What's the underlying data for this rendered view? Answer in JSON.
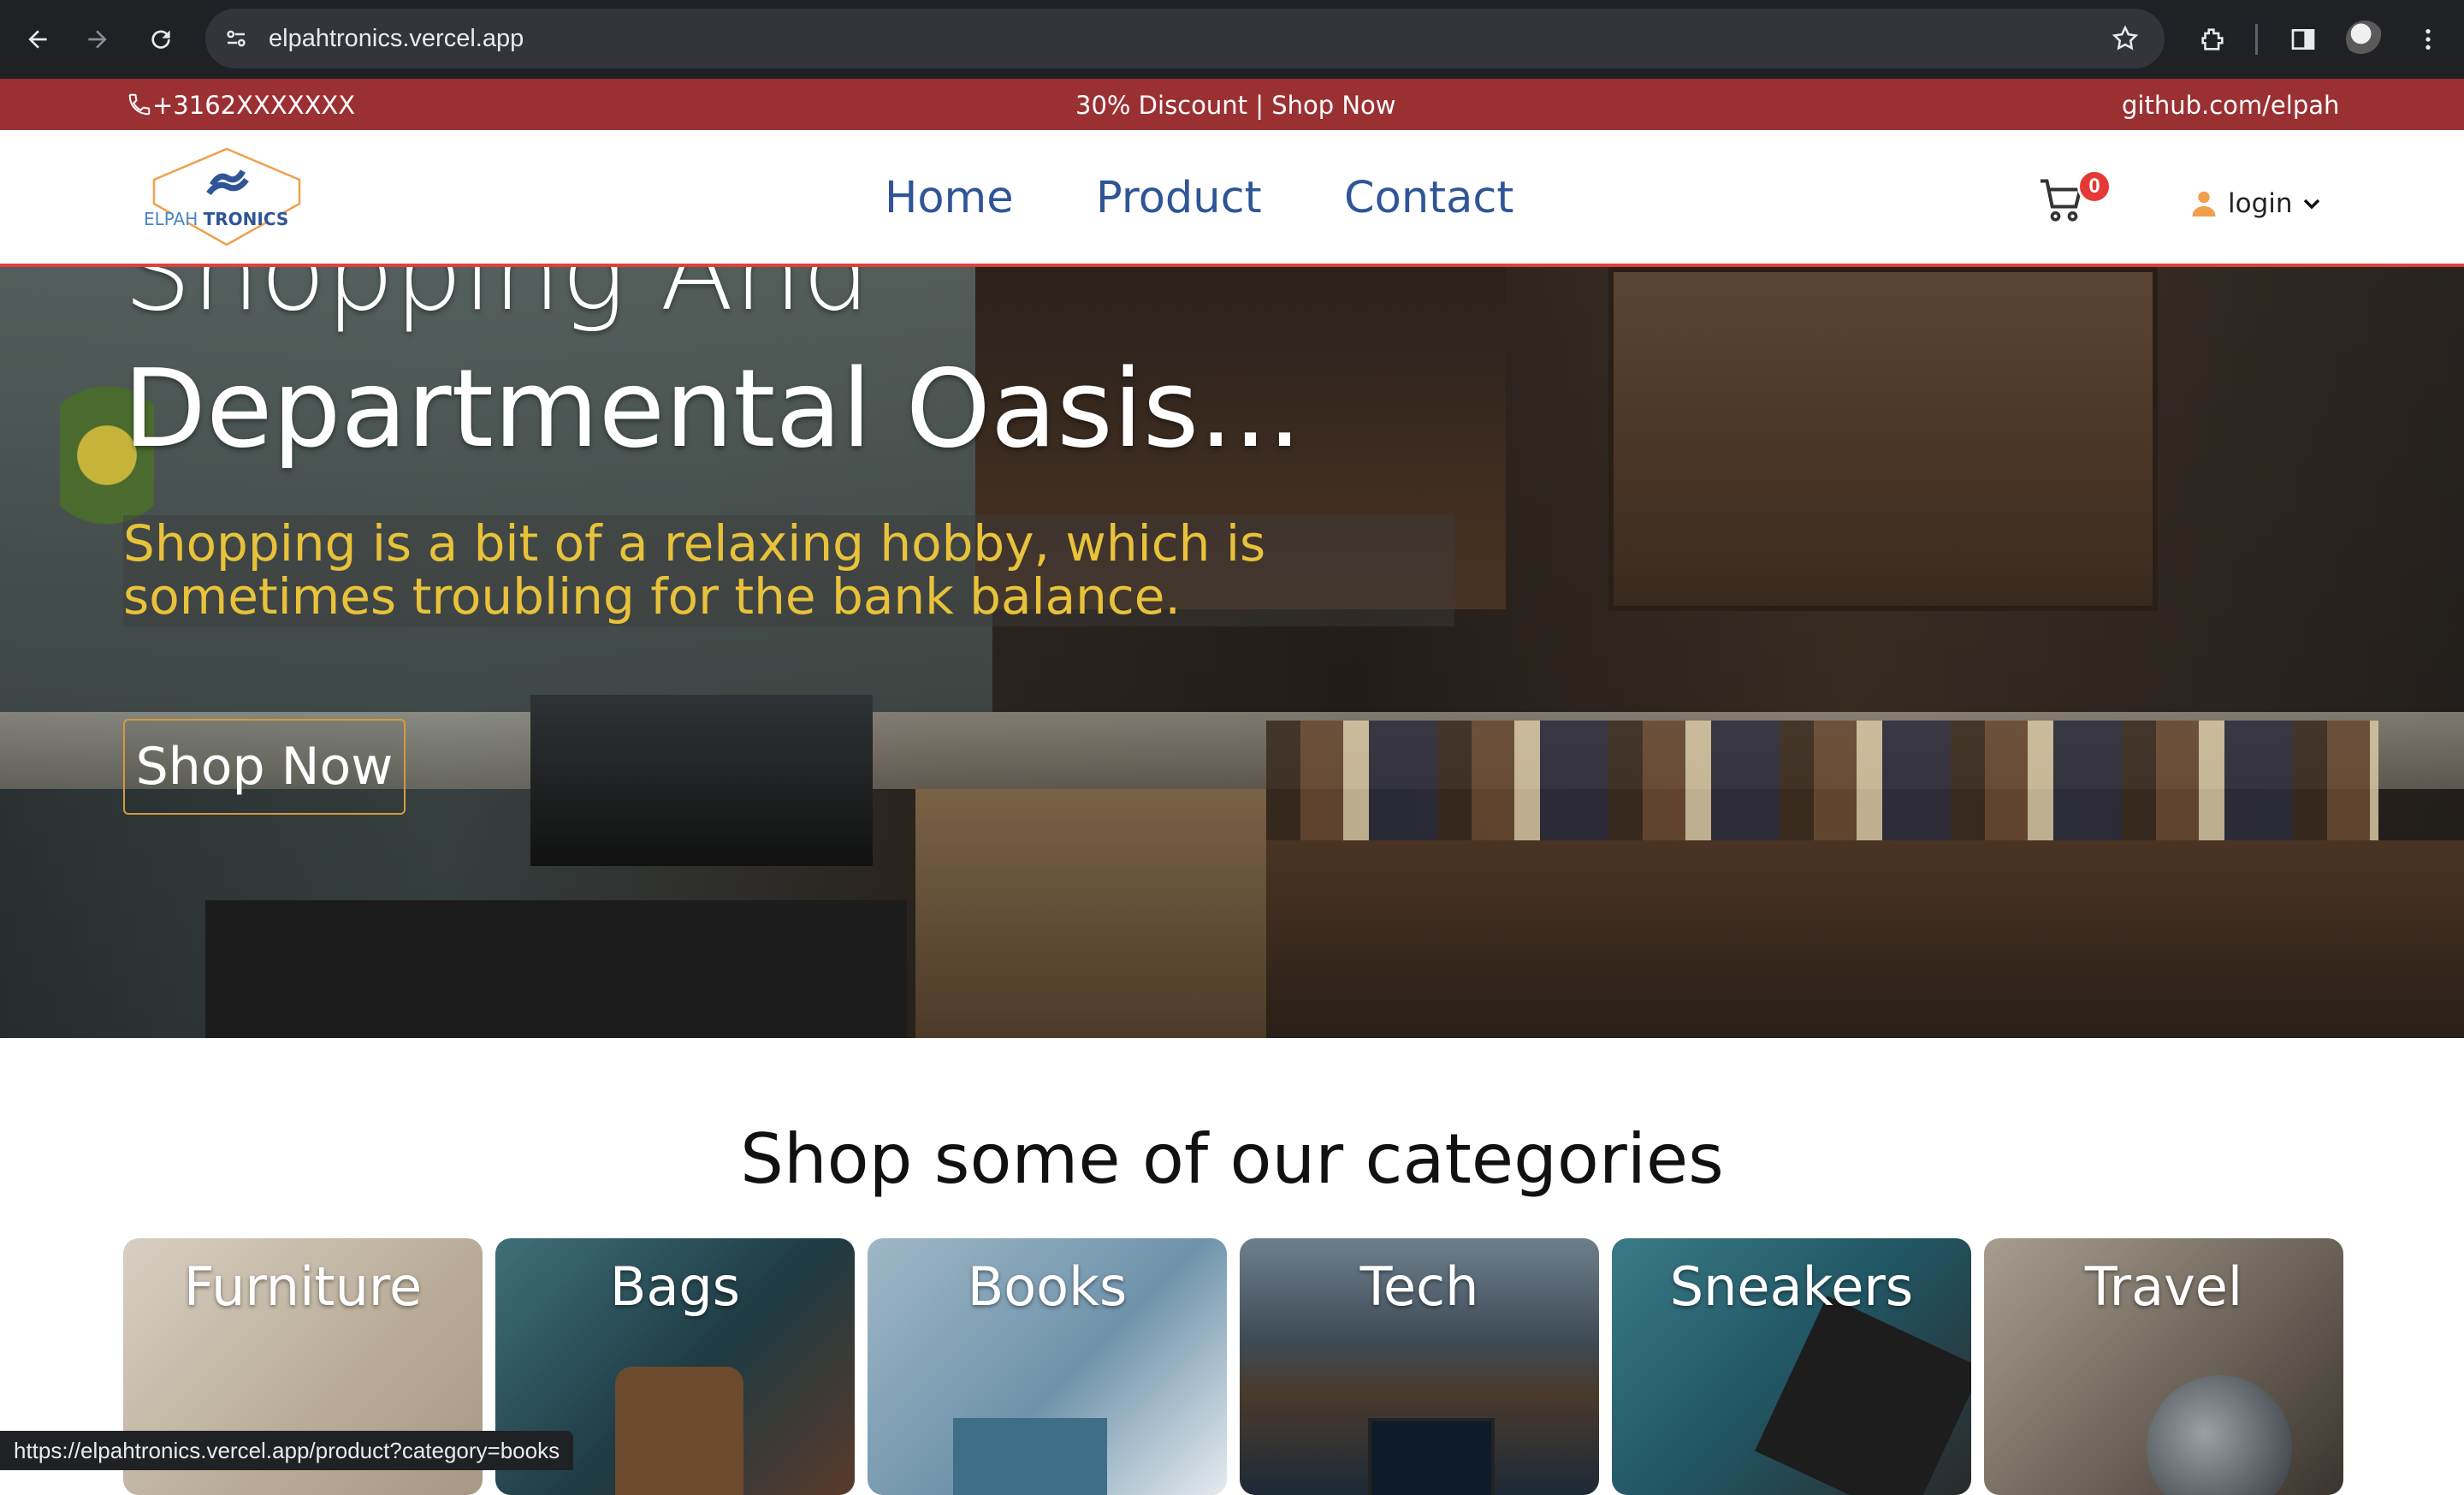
{
  "browser": {
    "url": "elpahtronics.vercel.app",
    "status_url": "https://elpahtronics.vercel.app/product?category=books"
  },
  "topbar": {
    "phone": "+3162XXXXXXX",
    "promo": "30% Discount | Shop Now",
    "github": "github.com/elpah"
  },
  "brand": {
    "logo_left": "ELPAH",
    "logo_right": "TRONICS",
    "accent_blue": "#2f5597",
    "accent_orange": "#f0a04b",
    "accent_red": "#9b3033"
  },
  "nav": {
    "items": [
      {
        "label": "Home"
      },
      {
        "label": "Product"
      },
      {
        "label": "Contact"
      }
    ],
    "cart_count": "0",
    "login_label": "login"
  },
  "hero": {
    "title_line1": "Shopping And",
    "title_line2": "Departmental Oasis...",
    "subtitle": "Shopping is a bit of a relaxing hobby, which is sometimes troubling for the bank balance.",
    "cta": "Shop Now"
  },
  "categories": {
    "heading": "Shop some of our categories",
    "items": [
      {
        "label": "Furniture"
      },
      {
        "label": "Bags"
      },
      {
        "label": "Books"
      },
      {
        "label": "Tech"
      },
      {
        "label": "Sneakers"
      },
      {
        "label": "Travel"
      }
    ]
  }
}
